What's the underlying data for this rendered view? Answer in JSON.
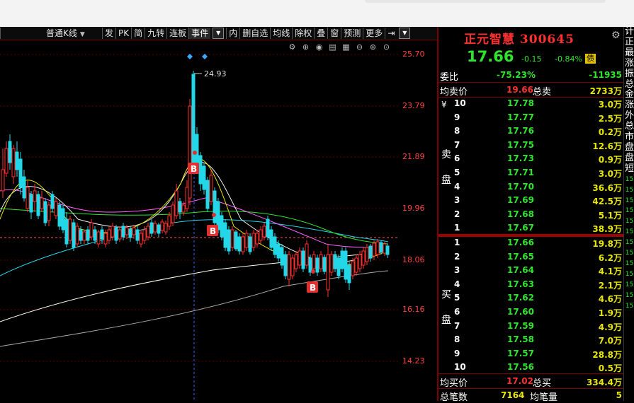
{
  "toolbar": {
    "period": "普通K线",
    "items": [
      "发",
      "PK",
      "简",
      "九转",
      "连板",
      "事件",
      "内",
      "删自选",
      "均线",
      "除权",
      "叠",
      "窗",
      "预测",
      "更多"
    ],
    "selected": "事件"
  },
  "chart": {
    "peak_label": "24.93",
    "marker": "B",
    "price_ticks": [
      "25.70",
      "23.79",
      "21.89",
      "19.96",
      "18.06",
      "16.16",
      "14.23"
    ]
  },
  "quote": {
    "name": "正元智慧",
    "code": "300645",
    "price": "17.66",
    "change": "-0.15",
    "pct": "-0.84%",
    "badge": "债",
    "weibi_label": "委比",
    "weibi_pct": "-75.23%",
    "weibi_diff": "-11935",
    "avg_sell_label": "均卖价",
    "avg_sell": "19.66",
    "total_sell_label": "总卖",
    "total_sell": "2733万",
    "sell_side_label_1": "卖",
    "sell_side_label_2": "盘",
    "buy_side_label_1": "买",
    "buy_side_label_2": "盘",
    "yen_symbol": "¥",
    "asks": [
      {
        "level": "10",
        "price": "17.78",
        "vol": "3.0万"
      },
      {
        "level": "9",
        "price": "17.77",
        "vol": "2.5万"
      },
      {
        "level": "8",
        "price": "17.76",
        "vol": "0.2万"
      },
      {
        "level": "7",
        "price": "17.75",
        "vol": "12.6万"
      },
      {
        "level": "6",
        "price": "17.73",
        "vol": "0.9万"
      },
      {
        "level": "5",
        "price": "17.71",
        "vol": "3.0万"
      },
      {
        "level": "4",
        "price": "17.70",
        "vol": "36.6万"
      },
      {
        "level": "3",
        "price": "17.69",
        "vol": "42.5万"
      },
      {
        "level": "2",
        "price": "17.68",
        "vol": "5.1万"
      },
      {
        "level": "1",
        "price": "17.67",
        "vol": "38.9万"
      }
    ],
    "bids": [
      {
        "level": "1",
        "price": "17.66",
        "vol": "19.8万"
      },
      {
        "level": "2",
        "price": "17.65",
        "vol": "6.2万"
      },
      {
        "level": "3",
        "price": "17.64",
        "vol": "4.1万"
      },
      {
        "level": "4",
        "price": "17.63",
        "vol": "2.1万"
      },
      {
        "level": "5",
        "price": "17.62",
        "vol": "4.6万"
      },
      {
        "level": "6",
        "price": "17.60",
        "vol": "1.9万"
      },
      {
        "level": "7",
        "price": "17.59",
        "vol": "4.9万"
      },
      {
        "level": "8",
        "price": "17.58",
        "vol": "7.0万"
      },
      {
        "level": "9",
        "price": "17.57",
        "vol": "28.8万"
      },
      {
        "level": "10",
        "price": "17.56",
        "vol": "0.5万"
      }
    ],
    "avg_buy_label": "均买价",
    "avg_buy": "17.02",
    "total_buy_label": "总买",
    "total_buy": "334.4万",
    "total_trades_label": "总笔数",
    "total_trades": "7164",
    "avg_trade_label": "均笔量",
    "avg_trade": "5"
  },
  "right_strip": {
    "chars": [
      "计",
      "正",
      "最",
      "涨",
      "振",
      "总",
      "金",
      "涨",
      "外",
      "总",
      "市",
      "盘",
      "盘",
      "短"
    ],
    "nums": [
      "15",
      "15",
      "15",
      "15",
      "15",
      "15",
      "15",
      "15",
      "15",
      "15",
      "15",
      "15",
      "15"
    ]
  },
  "colors": {
    "up": "#ff3030",
    "down": "#22d8e8",
    "price_down": "#2ee52e",
    "volume": "#e6e600",
    "separator": "#7a0000"
  }
}
